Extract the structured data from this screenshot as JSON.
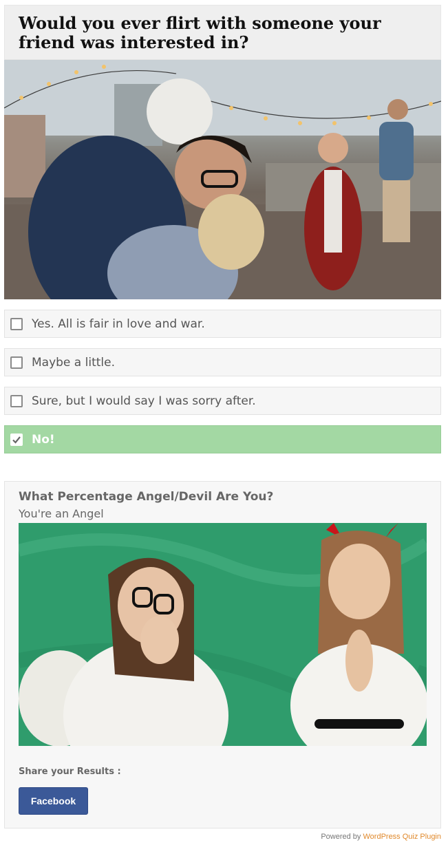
{
  "question": {
    "title": "Would you ever flirt with someone your friend was interested in?"
  },
  "answers": [
    {
      "label": "Yes. All is fair in love and war.",
      "selected": false
    },
    {
      "label": "Maybe a little.",
      "selected": false
    },
    {
      "label": "Sure, but I would say I was sorry after.",
      "selected": false
    },
    {
      "label": "No!",
      "selected": true
    }
  ],
  "result": {
    "quiz_title": "What Percentage Angel/Devil Are You?",
    "outcome": "You're an Angel",
    "share_label": "Share your Results :",
    "facebook_label": "Facebook"
  },
  "footer": {
    "powered_prefix": "Powered by",
    "plugin_link": "WordPress Quiz Plugin"
  },
  "colors": {
    "selected_answer": "#a3d8a3",
    "facebook": "#3b5998",
    "plugin_link": "#e0882a"
  },
  "icons": {
    "checkbox_checked": "check-icon"
  }
}
